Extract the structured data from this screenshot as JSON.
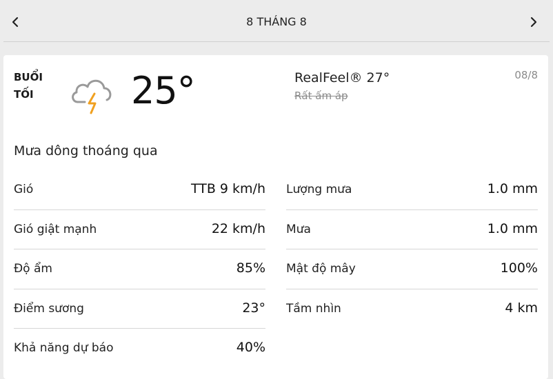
{
  "header": {
    "date_label": "8 THÁNG 8",
    "prev_icon": "chevron-left-icon",
    "next_icon": "chevron-right-icon"
  },
  "summary": {
    "period": "BUỔI TỐI",
    "icon": "thunderstorm-cloud-icon",
    "temperature": "25°",
    "realfeel": "RealFeel® 27°",
    "realfeel_desc": "Rất ấm áp",
    "date_code": "08/8",
    "phrase": "Mưa dông thoáng qua"
  },
  "details": {
    "left": [
      {
        "label": "Gió",
        "value": "TTB 9 km/h"
      },
      {
        "label": "Gió giật mạnh",
        "value": "22 km/h"
      },
      {
        "label": "Độ ẩm",
        "value": "85%"
      },
      {
        "label": "Điểm sương",
        "value": "23°"
      },
      {
        "label": "Khả năng dự báo",
        "value": "40%"
      }
    ],
    "right": [
      {
        "label": "Lượng mưa",
        "value": "1.0 mm"
      },
      {
        "label": "Mưa",
        "value": "1.0 mm"
      },
      {
        "label": "Mật độ mây",
        "value": "100%"
      },
      {
        "label": "Tầm nhìn",
        "value": "4 km"
      }
    ]
  },
  "colors": {
    "background": "#ececec",
    "card": "#ffffff",
    "lightning": "#f0a020"
  }
}
